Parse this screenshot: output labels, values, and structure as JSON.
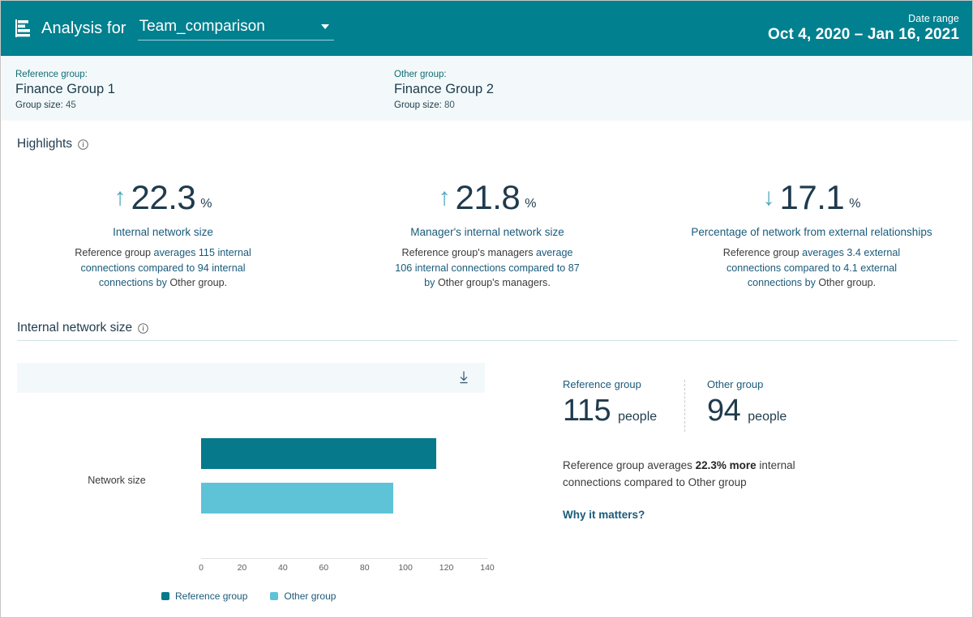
{
  "header": {
    "icon": "report-icon",
    "title": "Analysis for",
    "report_name": "Team_comparison",
    "caret_icon": "chevron-down-icon",
    "date_label": "Date range",
    "date_value": "Oct 4, 2020 – Jan 16, 2021",
    "background_color": "#01808f"
  },
  "groups": {
    "reference": {
      "kicker": "Reference group:",
      "name": "Finance Group 1",
      "size_label": "Group size:",
      "size_value": "45"
    },
    "other": {
      "kicker": "Other group:",
      "name": "Finance Group 2",
      "size_label": "Group size:",
      "size_value": "80"
    }
  },
  "highlights": {
    "title": "Highlights",
    "info_icon": "info-icon",
    "cards": [
      {
        "arrow": "↑",
        "direction": "up",
        "value": "22.3",
        "unit": "%",
        "label": "Internal network size",
        "desc_part1": "Reference group",
        "desc_part2": " averages 115 internal connections compared to 94 internal connections by ",
        "desc_part3": "Other group",
        "desc_part4": "."
      },
      {
        "arrow": "↑",
        "direction": "up",
        "value": "21.8",
        "unit": "%",
        "label": "Manager's internal network size",
        "desc_part1": "Reference group's managers",
        "desc_part2": " average 106 internal connections compared to 87 by ",
        "desc_part3": "Other group's managers",
        "desc_part4": "."
      },
      {
        "arrow": "↓",
        "direction": "down",
        "value": "17.1",
        "unit": "%",
        "label": "Percentage of network from external relationships",
        "desc_part1": "Reference group",
        "desc_part2": " averages 3.4 external connections compared to 4.1 external connections by ",
        "desc_part3": "Other group",
        "desc_part4": "."
      }
    ]
  },
  "internal_network_section": {
    "title": "Internal network size",
    "info_icon": "info-icon",
    "download_icon": "download-icon"
  },
  "chart_data": {
    "type": "bar",
    "orientation": "horizontal",
    "title": "Internal network size",
    "categories": [
      "Network size"
    ],
    "series": [
      {
        "name": "Reference group",
        "values": [
          115
        ],
        "color": "#06798b"
      },
      {
        "name": "Other group",
        "values": [
          94
        ],
        "color": "#5fc3d8"
      }
    ],
    "xlabel": "",
    "ylabel": "Network size",
    "xlim": [
      0,
      140
    ],
    "xticks": [
      0,
      20,
      40,
      60,
      80,
      100,
      120,
      140
    ],
    "xtick_labels": [
      "0",
      "20",
      "40",
      "60",
      "80",
      "100",
      "120",
      "140"
    ],
    "grid": false,
    "legend_position": "bottom-left"
  },
  "summary": {
    "reference": {
      "title": "Reference group",
      "value": "115",
      "unit": "people"
    },
    "other": {
      "title": "Other group",
      "value": "94",
      "unit": "people"
    },
    "text_part1": "Reference group averages ",
    "text_bold": "22.3% more",
    "text_part2": " internal connections compared to Other group",
    "why_link": "Why it matters?"
  }
}
